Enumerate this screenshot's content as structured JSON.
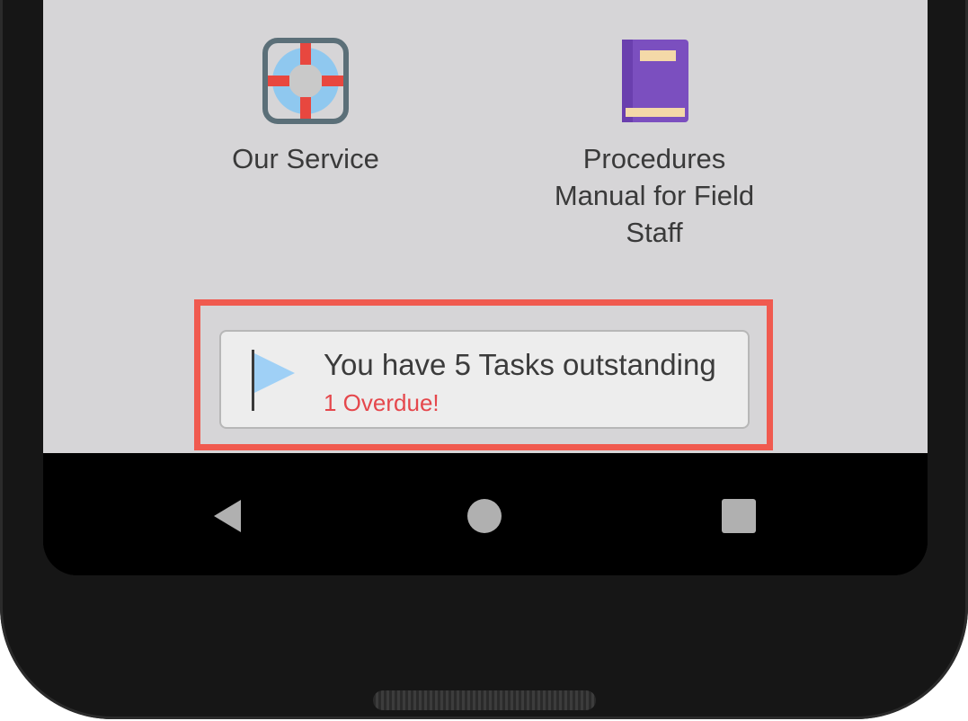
{
  "tiles": [
    {
      "label": "Our Service",
      "icon": "lifebuoy-icon"
    },
    {
      "label": "Procedures Manual for Field Staff",
      "icon": "book-icon"
    }
  ],
  "tasks_banner": {
    "title": "You have 5 Tasks outstanding",
    "subtitle": "1 Overdue!",
    "icon": "flag-icon",
    "subtitle_color": "#e5474c",
    "highlight_color": "#f05a4f"
  },
  "navigation": {
    "back": "back-icon",
    "home": "home-icon",
    "recents": "recents-icon"
  }
}
